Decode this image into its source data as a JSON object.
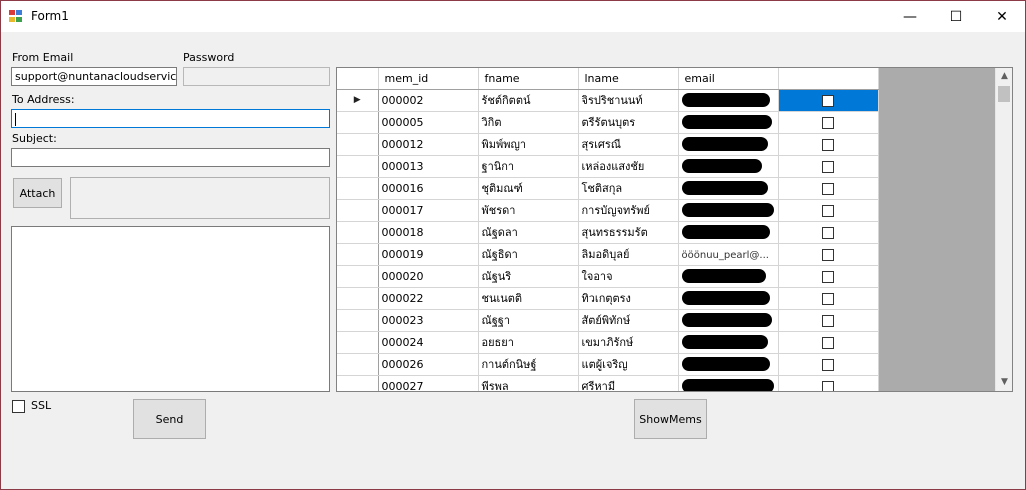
{
  "window": {
    "title": "Form1",
    "minimize_glyph": "—",
    "maximize_glyph": "☐",
    "close_glyph": "✕"
  },
  "form": {
    "from_email_label": "From Email",
    "from_email_value": "support@nuntanacloudservice.com",
    "password_label": "Password",
    "password_value": "",
    "to_address_label": "To Address:",
    "to_address_value": "",
    "subject_label": "Subject:",
    "subject_value": "",
    "attach_label": "Attach",
    "ssl_label": "SSL",
    "send_label": "Send",
    "showmems_label": "ShowMems"
  },
  "grid": {
    "columns": [
      "mem_id",
      "fname",
      "lname",
      "email"
    ],
    "current_row_marker": "▶",
    "rows": [
      {
        "mem_id": "000002",
        "fname": "รัชต์กิตตน์",
        "lname": "จิรปริชานนท์",
        "email": "",
        "redact": 88,
        "checked": false,
        "selected": true
      },
      {
        "mem_id": "000005",
        "fname": "วิกิต",
        "lname": "ตรีรัตนบุตร",
        "email": "",
        "redact": 90,
        "checked": false
      },
      {
        "mem_id": "000012",
        "fname": "พิมพ์พญา",
        "lname": "สุรเศรณี",
        "email": "",
        "redact": 86,
        "checked": false
      },
      {
        "mem_id": "000013",
        "fname": "ฐานิกา",
        "lname": "เหล่องแสงชัย",
        "email": "",
        "redact": 80,
        "checked": false
      },
      {
        "mem_id": "000016",
        "fname": "ชุติมณฑ์",
        "lname": "โชติสกุล",
        "email": "",
        "redact": 86,
        "checked": false
      },
      {
        "mem_id": "000017",
        "fname": "พัชรดา",
        "lname": "การบัญจทรัพย์",
        "email": "",
        "redact": 92,
        "checked": false
      },
      {
        "mem_id": "000018",
        "fname": "ณัฐดลา",
        "lname": "สุนทรธรรมรัต",
        "email": "",
        "redact": 88,
        "checked": false
      },
      {
        "mem_id": "000019",
        "fname": "ณัฐธิดา",
        "lname": "ลิมอดิบุลย์",
        "email": "ӧӧӧnuu_pearl@...",
        "redact": 0,
        "checked": false
      },
      {
        "mem_id": "000020",
        "fname": "ณัฐนริ",
        "lname": "ใจอาจ",
        "email": "",
        "redact": 84,
        "checked": false
      },
      {
        "mem_id": "000022",
        "fname": "ชนเนตติ",
        "lname": "ทิวเกตุตรง",
        "email": "",
        "redact": 88,
        "checked": false
      },
      {
        "mem_id": "000023",
        "fname": "ณัฐฐา",
        "lname": "สัตย์พิทักษ์",
        "email": "",
        "redact": 90,
        "checked": false
      },
      {
        "mem_id": "000024",
        "fname": "อยธยา",
        "lname": "เขมาภิรักษ์",
        "email": "",
        "redact": 86,
        "checked": false
      },
      {
        "mem_id": "000026",
        "fname": "กานต์กนิษฐ์",
        "lname": "แตผู้เจริญ",
        "email": "",
        "redact": 88,
        "checked": false
      },
      {
        "mem_id": "000027",
        "fname": "พีรพล",
        "lname": "ศรีหามี",
        "email": "",
        "redact": 92,
        "checked": false
      }
    ]
  },
  "scrollbar": {
    "up_glyph": "▲",
    "down_glyph": "▼"
  },
  "colors": {
    "selection": "#0078d7",
    "grid_background": "#ababab",
    "window_border": "#8d3a47"
  }
}
